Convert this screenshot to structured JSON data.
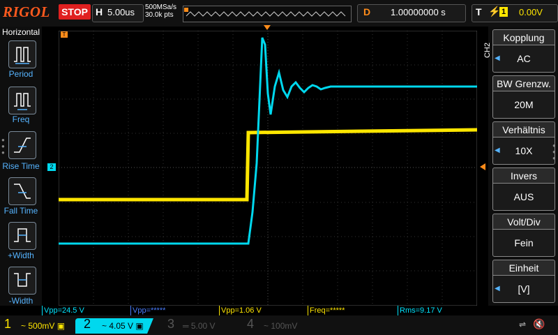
{
  "header": {
    "brand": "RIGOL",
    "run_state": "STOP",
    "horizontal_label": "H",
    "timebase": "5.00us",
    "sample_rate": "500MSa/s",
    "points": "30.0k pts",
    "delay_label": "D",
    "delay_value": "1.00000000 s",
    "trigger_label": "T",
    "trigger_source": "1",
    "trigger_level": "0.00V"
  },
  "left_menu": {
    "title": "Horizontal",
    "items": [
      {
        "label": "Period"
      },
      {
        "label": "Freq"
      },
      {
        "label": "Rise Time"
      },
      {
        "label": "Fall Time"
      },
      {
        "label": "+Width"
      },
      {
        "label": "-Width"
      }
    ]
  },
  "right_menu": {
    "channel_tag": "CH2",
    "items": [
      {
        "title": "Kopplung",
        "value": "AC"
      },
      {
        "title": "BW Grenzw.",
        "value": "20M"
      },
      {
        "title": "Verhältnis",
        "value": "10X"
      },
      {
        "title": "Invers",
        "value": "AUS"
      },
      {
        "title": "Volt/Div",
        "value": "Fein"
      },
      {
        "title": "Einheit",
        "value": "[V]"
      }
    ]
  },
  "markers": {
    "trigger_top": "T",
    "ch2_ref": "2"
  },
  "measurements": [
    {
      "text": "Vpp=24.5 V",
      "color": "#00e5ff"
    },
    {
      "text": "Vpp=*****",
      "color": "#4a7dff"
    },
    {
      "text": "Vpp=1.06 V",
      "color": "#ffe600"
    },
    {
      "text": "Freq=*****",
      "color": "#ffe600"
    },
    {
      "text": "Rms=9.17 V",
      "color": "#00e5ff"
    }
  ],
  "channels": [
    {
      "num": "1",
      "scale": "500mV",
      "color": "#ffe600"
    },
    {
      "num": "2",
      "scale": "4.05 V",
      "color": "#00e5ff"
    },
    {
      "num": "3",
      "scale": "5.00 V",
      "color": "#555555"
    },
    {
      "num": "4",
      "scale": "100mV",
      "color": "#555555"
    }
  ],
  "colors": {
    "ch1": "#ffe600",
    "ch2": "#00e5ff",
    "accent": "#ff8c1a"
  }
}
